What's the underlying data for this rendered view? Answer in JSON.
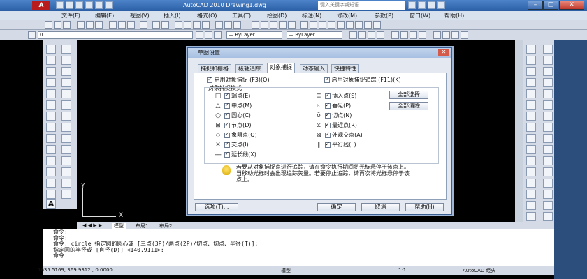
{
  "window": {
    "title": "AutoCAD 2010    Drawing1.dwg",
    "logo": "A",
    "search_placeholder": "键入关键字或短语",
    "min": "–",
    "max": "□",
    "close": "✕"
  },
  "menu": [
    "文件(F)",
    "编辑(E)",
    "视图(V)",
    "插入(I)",
    "格式(O)",
    "工具(T)",
    "绘图(D)",
    "标注(N)",
    "修改(M)",
    "参数(P)",
    "窗口(W)",
    "帮助(H)"
  ],
  "toolbar": {
    "layer_value": "0",
    "bylayer1": "— ByLayer",
    "bylayer2": "— ByLayer"
  },
  "dialog": {
    "title": "草图设置",
    "close": "✕",
    "tabs": [
      "捕捉和栅格",
      "极轴追踪",
      "对象捕捉",
      "动态输入",
      "快捷特性"
    ],
    "active_tab": 2,
    "enable_snap": "启用对象捕捉 (F3)(O)",
    "enable_track": "启用对象捕捉追踪 (F11)(K)",
    "group_label": "对象捕捉模式",
    "left_modes": [
      {
        "sym": "□",
        "label": "端点(E)"
      },
      {
        "sym": "△",
        "label": "中点(M)"
      },
      {
        "sym": "○",
        "label": "圆心(C)"
      },
      {
        "sym": "⊠",
        "label": "节点(D)"
      },
      {
        "sym": "◇",
        "label": "象限点(Q)"
      },
      {
        "sym": "✕",
        "label": "交点(I)"
      },
      {
        "sym": "---",
        "label": "延长线(X)"
      }
    ],
    "right_modes": [
      {
        "sym": "⊑",
        "label": "插入点(S)"
      },
      {
        "sym": "⊾",
        "label": "垂足(P)"
      },
      {
        "sym": "ō",
        "label": "切点(N)"
      },
      {
        "sym": "⧖",
        "label": "最近点(R)"
      },
      {
        "sym": "⊠",
        "label": "外观交点(A)"
      },
      {
        "sym": "∥",
        "label": "平行线(L)"
      }
    ],
    "select_all": "全部选择",
    "clear_all": "全部清除",
    "hint": "若要从对象捕捉点进行追踪，请在命令执行期间将光标悬停于该点上。当移动光标时会出现追踪矢量。若要停止追踪，请再次将光标悬停于该点上。",
    "options": "选项(T)...",
    "ok": "确定",
    "cancel": "取消",
    "help": "帮助(H)"
  },
  "tabs": [
    "模型",
    "布局1",
    "布局2"
  ],
  "ucs": {
    "x": "X",
    "y": "Y"
  },
  "command_lines": [
    "命令:",
    "命令:",
    "命令:  circle 指定圆的圆心或 [三点(3P)/两点(2P)/切点、切点、半径(T)]:",
    "指定圆的半径或 [直径(D)] <140.9111>:",
    "命令:"
  ],
  "status": {
    "coords": "1635.5169, 369.9312 , 0.0000",
    "model": "模型",
    "scale": "1:1",
    "workspace": "AutoCAD 经典"
  }
}
